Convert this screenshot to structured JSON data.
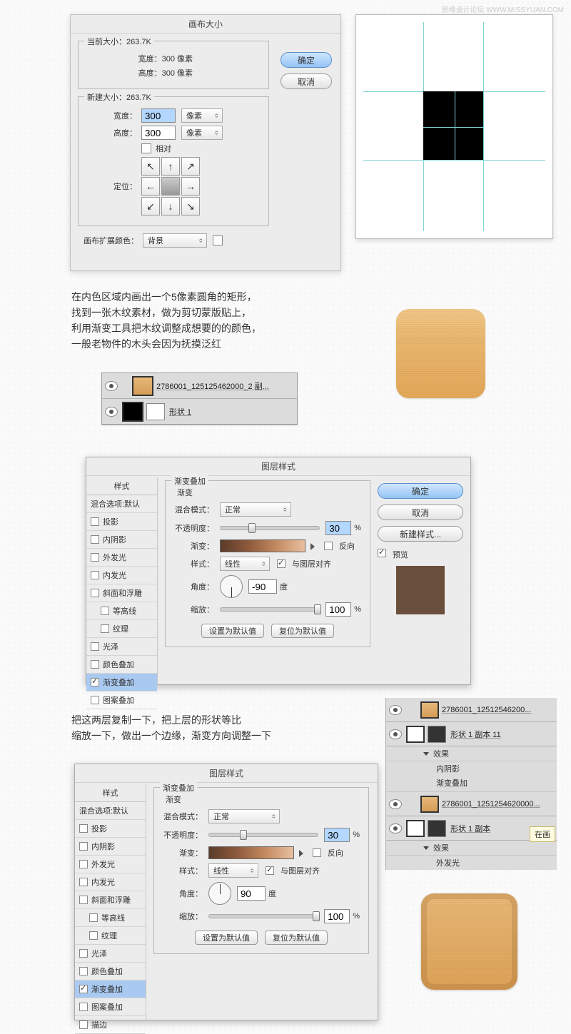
{
  "watermark": "思缘设计论坛  WWW.MISSYUAN.COM",
  "canvasDialog": {
    "title": "画布大小",
    "current": {
      "legend": "当前大小：263.7K",
      "widthLabel": "宽度：300 像素",
      "heightLabel": "高度：300 像素"
    },
    "newsize": {
      "legend": "新建大小：263.7K",
      "widthLabel": "宽度：",
      "widthVal": "300",
      "widthUnit": "像素",
      "heightLabel": "高度：",
      "heightVal": "300",
      "heightUnit": "像素",
      "relativeLabel": "相对",
      "anchorLabel": "定位："
    },
    "extLabel": "画布扩展颜色：",
    "extVal": "背景",
    "ok": "确定",
    "cancel": "取消"
  },
  "text1": {
    "l1": "在内色区域内画出一个5像素圆角的矩形，",
    "l2": "找到一张木纹素材，做为剪切蒙版贴上，",
    "l3": "利用渐变工具把木纹调整成想要的的颜色，",
    "l4": "一般老物件的木头会因为抚摸泛红"
  },
  "layers1": {
    "row1": "2786001_125125462000_2 副...",
    "row2": "形状 1"
  },
  "layerStyle": {
    "title": "图层样式",
    "leftTitle": "样式",
    "blendDefault": "混合选项:默认",
    "items": [
      "投影",
      "内阴影",
      "外发光",
      "内发光",
      "斜面和浮雕",
      "等高线",
      "纹理",
      "光泽",
      "颜色叠加",
      "渐变叠加",
      "图案叠加"
    ],
    "items2": [
      "投影",
      "内阴影",
      "外发光",
      "内发光",
      "斜面和浮雕",
      "等高线",
      "纹理",
      "光泽",
      "颜色叠加",
      "渐变叠加",
      "图案叠加",
      "描边"
    ],
    "section": "渐变叠加",
    "subsection": "渐变",
    "blendModeLabel": "混合模式：",
    "blendModeVal": "正常",
    "opacityLabel": "不透明度：",
    "opacityVal": "30",
    "pct": "%",
    "gradLabel": "渐变：",
    "reverseLabel": "反向",
    "styleLabel": "样式：",
    "styleVal": "线性",
    "alignLabel": "与图层对齐",
    "angleLabel": "角度：",
    "angleVal1": "-90",
    "angleVal2": "90",
    "deg": "度",
    "scaleLabel": "缩放：",
    "scaleVal": "100",
    "setDefault": "设置为默认值",
    "resetDefault": "复位为默认值",
    "ok": "确定",
    "cancel": "取消",
    "newStyle": "新建样式...",
    "previewLabel": "预览"
  },
  "text2": {
    "l1": "把这两层复制一下，把上层的形状等比",
    "l2": "缩放一下，做出一个边缘，渐变方向调整一下"
  },
  "layers2": {
    "r1": "2786001_12512546200...",
    "r2": "形状 1 副本 11",
    "fx": "效果",
    "fx1": "内阴影",
    "fx2": "渐变叠加",
    "r3": "2786001_1251254620000...",
    "r4": "形状 1 副本",
    "fx3": "外发光",
    "tag": "在画"
  }
}
